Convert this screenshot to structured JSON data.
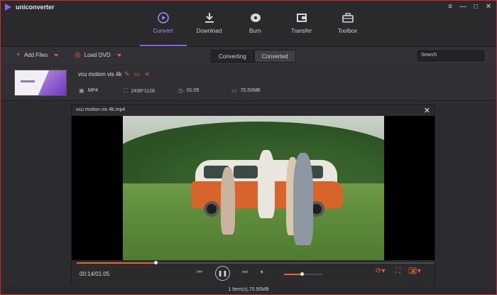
{
  "app": {
    "title": "uniconverter"
  },
  "window_controls": {
    "menu": "≡",
    "minimize": "—",
    "maximize": "□",
    "close": "✕"
  },
  "nav": [
    {
      "label": "Convert",
      "icon": "convert-icon"
    },
    {
      "label": "Download",
      "icon": "download-icon"
    },
    {
      "label": "Burn",
      "icon": "burn-icon"
    },
    {
      "label": "Transfer",
      "icon": "transfer-icon"
    },
    {
      "label": "Toolbox",
      "icon": "toolbox-icon"
    }
  ],
  "toolbar": {
    "add_files": "Add Files",
    "load_dvd": "Load DVD",
    "tabs": [
      "Converting",
      "Converted"
    ],
    "search_placeholder": "Search"
  },
  "file": {
    "name": "vcu motion vis 4k",
    "format": "MP4",
    "resolution": "2436*1126",
    "duration": "01:05",
    "size": "70.50MB"
  },
  "player": {
    "title": "vcu motion vis 4k.mp4",
    "time": "00:14/01:05",
    "progress": 0.22,
    "volume": 0.47
  },
  "status": {
    "text": "1 Item(s),70.50MB"
  },
  "colors": {
    "accent": "#e0653a",
    "brand": "#8a63e8",
    "frame": "#b9323a"
  }
}
